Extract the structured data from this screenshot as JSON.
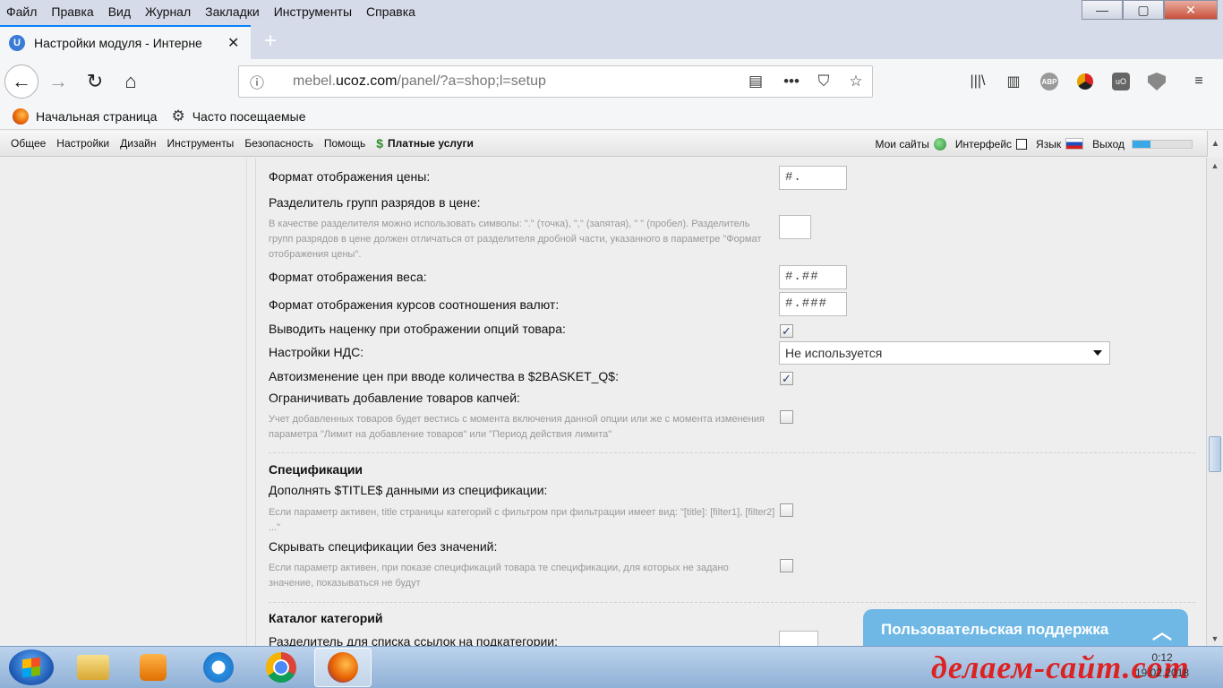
{
  "menubar": [
    "Файл",
    "Правка",
    "Вид",
    "Журнал",
    "Закладки",
    "Инструменты",
    "Справка"
  ],
  "window_controls": {
    "minimize": "—",
    "maximize": "▢",
    "close": "✕"
  },
  "tab": {
    "favicon": "U",
    "title": "Настройки модуля - Интерне",
    "close": "✕"
  },
  "newtab": "+",
  "nav": {
    "back": "←",
    "forward": "→",
    "reload": "↻",
    "home": "⌂"
  },
  "url": {
    "info": "ⓘ",
    "prefix": "mebel.",
    "domain": "ucoz.com",
    "path": "/panel/?a=shop;l=setup",
    "reader": "▤",
    "more": "•••",
    "pocket": "⛉",
    "star": "☆"
  },
  "toolbar": {
    "library": "|||\\",
    "sidebar": "▥",
    "abp": "ABP",
    "ub": "uO",
    "menu": "≡"
  },
  "bookmarks": [
    {
      "label": "Начальная страница"
    },
    {
      "label": "Часто посещаемые"
    }
  ],
  "ucoz_menu": [
    "Общее",
    "Настройки",
    "Дизайн",
    "Инструменты",
    "Безопасность",
    "Помощь"
  ],
  "ucoz_paid": {
    "icon": "$",
    "label": "Платные услуги"
  },
  "ucoz_right": {
    "my_sites": "Мои сайты",
    "interface": "Интерфейс",
    "language": "Язык",
    "logout": "Выход",
    "progress": 0.3
  },
  "settings": {
    "price_format": {
      "label": "Формат отображения цены:",
      "value": "#."
    },
    "digit_sep": {
      "label": "Разделитель групп разрядов в цене:",
      "hint": "В качестве разделителя можно использовать символы: \".\" (точка), \",\" (запятая), \" \" (пробел). Разделитель групп разрядов в цене должен отличаться от разделителя дробной части, указанного в параметре \"Формат отображения цены\".",
      "value": ""
    },
    "weight_format": {
      "label": "Формат отображения веса:",
      "value": "#.##"
    },
    "rate_format": {
      "label": "Формат отображения курсов соотношения валют:",
      "value": "#.###"
    },
    "markup": {
      "label": "Выводить наценку при отображении опций товара:",
      "checked": "✓"
    },
    "vat": {
      "label": "Настройки НДС:",
      "value": "Не используется"
    },
    "autochange": {
      "label": "Автоизменение цен при вводе количества в $2BASKET_Q$:",
      "checked": "✓"
    },
    "captcha": {
      "label": "Ограничивать добавление товаров капчей:",
      "hint": "Учет добавленных товаров будет вестись с момента включения данной опции или же с момента изменения параметра \"Лимит на добавление товаров\" или \"Период действия лимита\"",
      "checked": ""
    }
  },
  "specs": {
    "title": "Спецификации",
    "title_add": {
      "label": "Дополнять $TITLE$ данными из спецификации:",
      "hint": "Если параметр активен, title страницы категорий с фильтром при фильтрации имеет вид: \"[title]: [filter1], [filter2] ...\"",
      "checked": ""
    },
    "hide_empty": {
      "label": "Скрывать спецификации без значений:",
      "hint": "Если параметр активен, при показе спецификаций товара те спецификации, для которых не задано значение, показываться не будут",
      "checked": ""
    }
  },
  "catalog": {
    "title": "Каталог категорий",
    "separator_label": "Разделитель для списка ссылок на подкатегории:"
  },
  "support": {
    "label": "Пользовательская поддержка",
    "chevron": "︿"
  },
  "taskbar": {
    "watermark": "делаем-сайт.com",
    "time": "0:12",
    "date": "19.02.2018"
  }
}
